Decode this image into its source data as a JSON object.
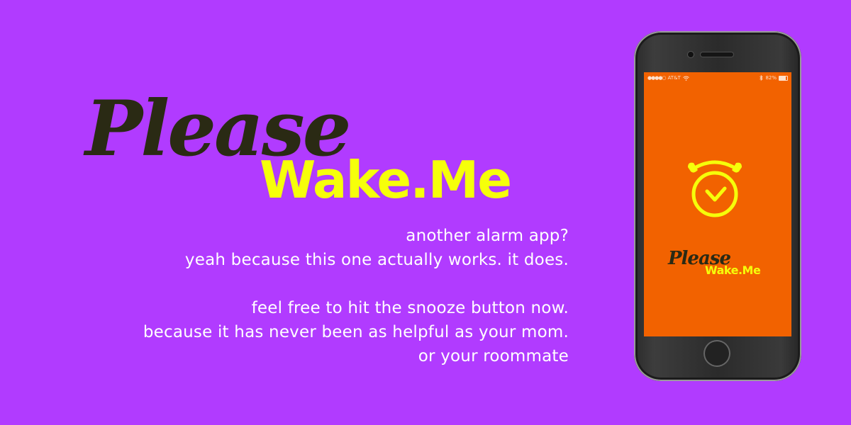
{
  "logo": {
    "line1": "Please",
    "line2": "Wake.Me"
  },
  "tagline": {
    "lines": [
      "another alarm app?",
      "yeah because this one actually works. it does.",
      "feel free to hit the snooze button now.",
      "because it has never been as helpful as your mom.",
      "or your roommate"
    ]
  },
  "phone": {
    "status": {
      "carrier_dots": "●●●●○",
      "carrier": "AT&T",
      "wifi_icon": "wifi-icon",
      "bluetooth_icon": "bluetooth-icon",
      "battery_percent": "82%"
    },
    "app_logo": {
      "line1": "Please",
      "line2": "Wake.Me"
    },
    "icon": "alarm-clock-icon"
  },
  "colors": {
    "background": "#b13bff",
    "accent_yellow": "#f6ff0a",
    "dark_text": "#2a2a14",
    "app_screen": "#f26200"
  }
}
